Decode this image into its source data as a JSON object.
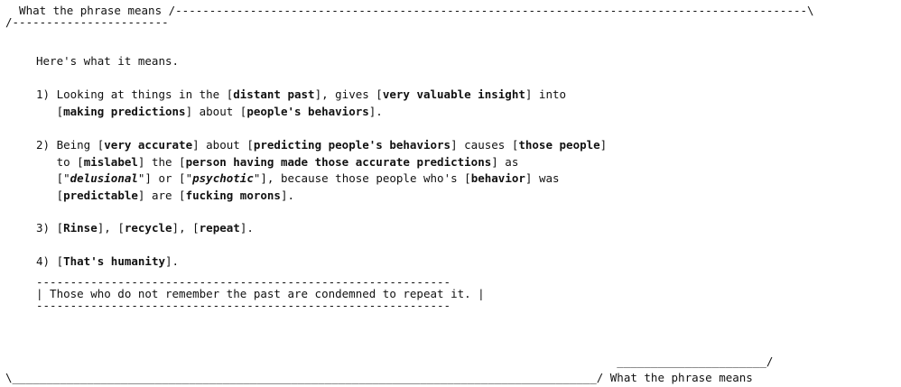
{
  "header": {
    "top_line": "  What the phrase means /---------------------------------------------------------------------------------------------\\",
    "second_line": "/-----------------------"
  },
  "intro": "Here's what it means.",
  "items": [
    {
      "lines": [
        [
          {
            "t": "1) Looking at things in the "
          },
          {
            "t": "[",
            "b": false
          },
          {
            "t": "distant past",
            "b": true
          },
          {
            "t": "], gives ["
          },
          {
            "t": "very valuable insight",
            "b": true
          },
          {
            "t": "] into"
          }
        ],
        [
          {
            "t": "   ["
          },
          {
            "t": "making predictions",
            "b": true
          },
          {
            "t": "] about ["
          },
          {
            "t": "people's behaviors",
            "b": true
          },
          {
            "t": "]."
          }
        ]
      ]
    },
    {
      "lines": [
        [
          {
            "t": "2) Being ["
          },
          {
            "t": "very accurate",
            "b": true
          },
          {
            "t": "] about ["
          },
          {
            "t": "predicting people's behaviors",
            "b": true
          },
          {
            "t": "] causes ["
          },
          {
            "t": "those people",
            "b": true
          },
          {
            "t": "]"
          }
        ],
        [
          {
            "t": "   to ["
          },
          {
            "t": "mislabel",
            "b": true
          },
          {
            "t": "] the ["
          },
          {
            "t": "person having made those accurate predictions",
            "b": true
          },
          {
            "t": "] as"
          }
        ],
        [
          {
            "t": "   [\""
          },
          {
            "t": "delusional",
            "b": true,
            "i": true
          },
          {
            "t": "\"] or [\""
          },
          {
            "t": "psychotic",
            "b": true,
            "i": true
          },
          {
            "t": "\"], because those people who's ["
          },
          {
            "t": "behavior",
            "b": true
          },
          {
            "t": "] was"
          }
        ],
        [
          {
            "t": "   ["
          },
          {
            "t": "predictable",
            "b": true
          },
          {
            "t": "] are ["
          },
          {
            "t": "fucking morons",
            "b": true
          },
          {
            "t": "]."
          }
        ]
      ]
    },
    {
      "lines": [
        [
          {
            "t": "3) ["
          },
          {
            "t": "Rinse",
            "b": true
          },
          {
            "t": "], ["
          },
          {
            "t": "recycle",
            "b": true
          },
          {
            "t": "], ["
          },
          {
            "t": "repeat",
            "b": true
          },
          {
            "t": "]."
          }
        ]
      ]
    },
    {
      "lines": [
        [
          {
            "t": "4) ["
          },
          {
            "t": "That's humanity",
            "b": true
          },
          {
            "t": "]."
          }
        ]
      ]
    }
  ],
  "quote_box": {
    "top_border": "-------------------------------------------------------------",
    "text": "| Those who do not remember the past are condemned to repeat it. |",
    "bottom_border": "-------------------------------------------------------------"
  },
  "footer": {
    "upper_line": "                                                                                          ______________________/",
    "bottom_line": "\\______________________________________________________________________________________/ What the phrase means"
  }
}
